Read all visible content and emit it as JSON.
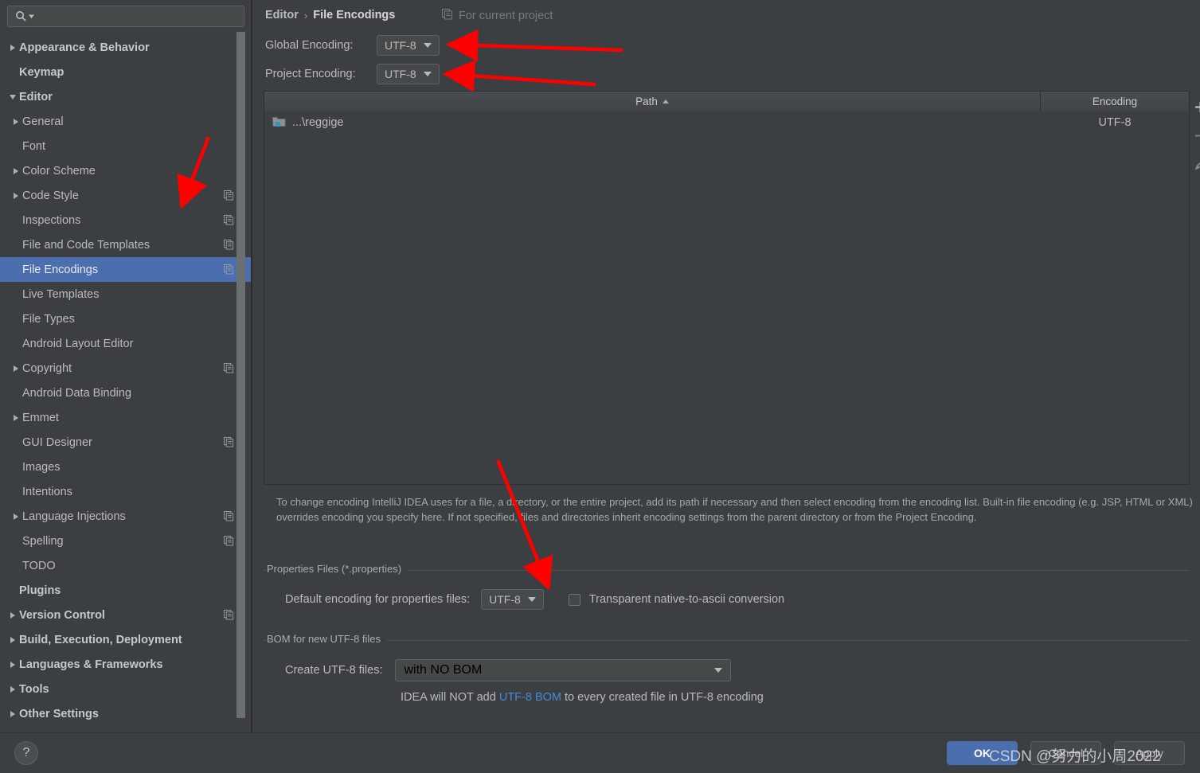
{
  "search": {
    "placeholder": "",
    "value": "",
    "icon": "search-icon"
  },
  "sidebar": {
    "items": [
      {
        "label": "Appearance & Behavior",
        "level": 0,
        "arrow": "right",
        "bold": true,
        "config": false,
        "selected": false
      },
      {
        "label": "Keymap",
        "level": 0,
        "arrow": "none",
        "bold": true,
        "config": false,
        "selected": false
      },
      {
        "label": "Editor",
        "level": 0,
        "arrow": "down",
        "bold": true,
        "config": false,
        "selected": false
      },
      {
        "label": "General",
        "level": 1,
        "arrow": "right",
        "bold": false,
        "config": false,
        "selected": false
      },
      {
        "label": "Font",
        "level": 1,
        "arrow": "none",
        "bold": false,
        "config": false,
        "selected": false
      },
      {
        "label": "Color Scheme",
        "level": 1,
        "arrow": "right",
        "bold": false,
        "config": false,
        "selected": false
      },
      {
        "label": "Code Style",
        "level": 1,
        "arrow": "right",
        "bold": false,
        "config": true,
        "selected": false
      },
      {
        "label": "Inspections",
        "level": 1,
        "arrow": "none",
        "bold": false,
        "config": true,
        "selected": false
      },
      {
        "label": "File and Code Templates",
        "level": 1,
        "arrow": "none",
        "bold": false,
        "config": true,
        "selected": false
      },
      {
        "label": "File Encodings",
        "level": 1,
        "arrow": "none",
        "bold": false,
        "config": true,
        "selected": true
      },
      {
        "label": "Live Templates",
        "level": 1,
        "arrow": "none",
        "bold": false,
        "config": false,
        "selected": false
      },
      {
        "label": "File Types",
        "level": 1,
        "arrow": "none",
        "bold": false,
        "config": false,
        "selected": false
      },
      {
        "label": "Android Layout Editor",
        "level": 1,
        "arrow": "none",
        "bold": false,
        "config": false,
        "selected": false
      },
      {
        "label": "Copyright",
        "level": 1,
        "arrow": "right",
        "bold": false,
        "config": true,
        "selected": false
      },
      {
        "label": "Android Data Binding",
        "level": 1,
        "arrow": "none",
        "bold": false,
        "config": false,
        "selected": false
      },
      {
        "label": "Emmet",
        "level": 1,
        "arrow": "right",
        "bold": false,
        "config": false,
        "selected": false
      },
      {
        "label": "GUI Designer",
        "level": 1,
        "arrow": "none",
        "bold": false,
        "config": true,
        "selected": false
      },
      {
        "label": "Images",
        "level": 1,
        "arrow": "none",
        "bold": false,
        "config": false,
        "selected": false
      },
      {
        "label": "Intentions",
        "level": 1,
        "arrow": "none",
        "bold": false,
        "config": false,
        "selected": false
      },
      {
        "label": "Language Injections",
        "level": 1,
        "arrow": "right",
        "bold": false,
        "config": true,
        "selected": false
      },
      {
        "label": "Spelling",
        "level": 1,
        "arrow": "none",
        "bold": false,
        "config": true,
        "selected": false
      },
      {
        "label": "TODO",
        "level": 1,
        "arrow": "none",
        "bold": false,
        "config": false,
        "selected": false
      },
      {
        "label": "Plugins",
        "level": 0,
        "arrow": "none",
        "bold": true,
        "config": false,
        "selected": false
      },
      {
        "label": "Version Control",
        "level": 0,
        "arrow": "right",
        "bold": true,
        "config": true,
        "selected": false
      },
      {
        "label": "Build, Execution, Deployment",
        "level": 0,
        "arrow": "right",
        "bold": true,
        "config": false,
        "selected": false
      },
      {
        "label": "Languages & Frameworks",
        "level": 0,
        "arrow": "right",
        "bold": true,
        "config": false,
        "selected": false
      },
      {
        "label": "Tools",
        "level": 0,
        "arrow": "right",
        "bold": true,
        "config": false,
        "selected": false
      },
      {
        "label": "Other Settings",
        "level": 0,
        "arrow": "right",
        "bold": true,
        "config": false,
        "selected": false
      }
    ]
  },
  "main": {
    "breadcrumb": {
      "root": "Editor",
      "separator": "›",
      "leaf": "File Encodings"
    },
    "for_current_project": "For current project",
    "global_encoding": {
      "label": "Global Encoding:",
      "value": "UTF-8"
    },
    "project_encoding": {
      "label": "Project Encoding:",
      "value": "UTF-8"
    },
    "table": {
      "columns": [
        "Path",
        "Encoding"
      ],
      "sort_column": "Path",
      "sort_direction": "asc",
      "rows": [
        {
          "path": "...\\reggige",
          "encoding": "UTF-8"
        }
      ],
      "tools": [
        "add-icon",
        "remove-icon",
        "edit-icon"
      ]
    },
    "description": "To change encoding IntelliJ IDEA uses for a file, a directory, or the entire project, add its path if necessary and then select encoding from the encoding list. Built-in file encoding (e.g. JSP, HTML or XML) overrides encoding you specify here. If not specified, files and directories inherit encoding settings from the parent directory or from the Project Encoding.",
    "properties_group": {
      "title": "Properties Files (*.properties)",
      "default_encoding_label": "Default encoding for properties files:",
      "default_encoding_value": "UTF-8",
      "transparent_checkbox_label": "Transparent native-to-ascii conversion",
      "transparent_checked": false
    },
    "bom_group": {
      "title": "BOM for new UTF-8 files",
      "create_label": "Create UTF-8 files:",
      "create_value": "with NO BOM",
      "hint_prefix": "IDEA will NOT add ",
      "hint_link": "UTF-8 BOM",
      "hint_suffix": " to every created file in UTF-8 encoding"
    }
  },
  "bottom": {
    "help_label": "?",
    "ok_label": "OK",
    "cancel_label": "Cancel",
    "apply_label": "Apply"
  },
  "watermark": {
    "text": "CSDN @努力的小周2022"
  },
  "colors": {
    "background": "#3c3f41",
    "selection": "#4b6eaf",
    "accent_button": "#4b6eaf",
    "link": "#4a88d6",
    "annotation_arrow": "#ff0000",
    "text": "#bbbbbb"
  }
}
